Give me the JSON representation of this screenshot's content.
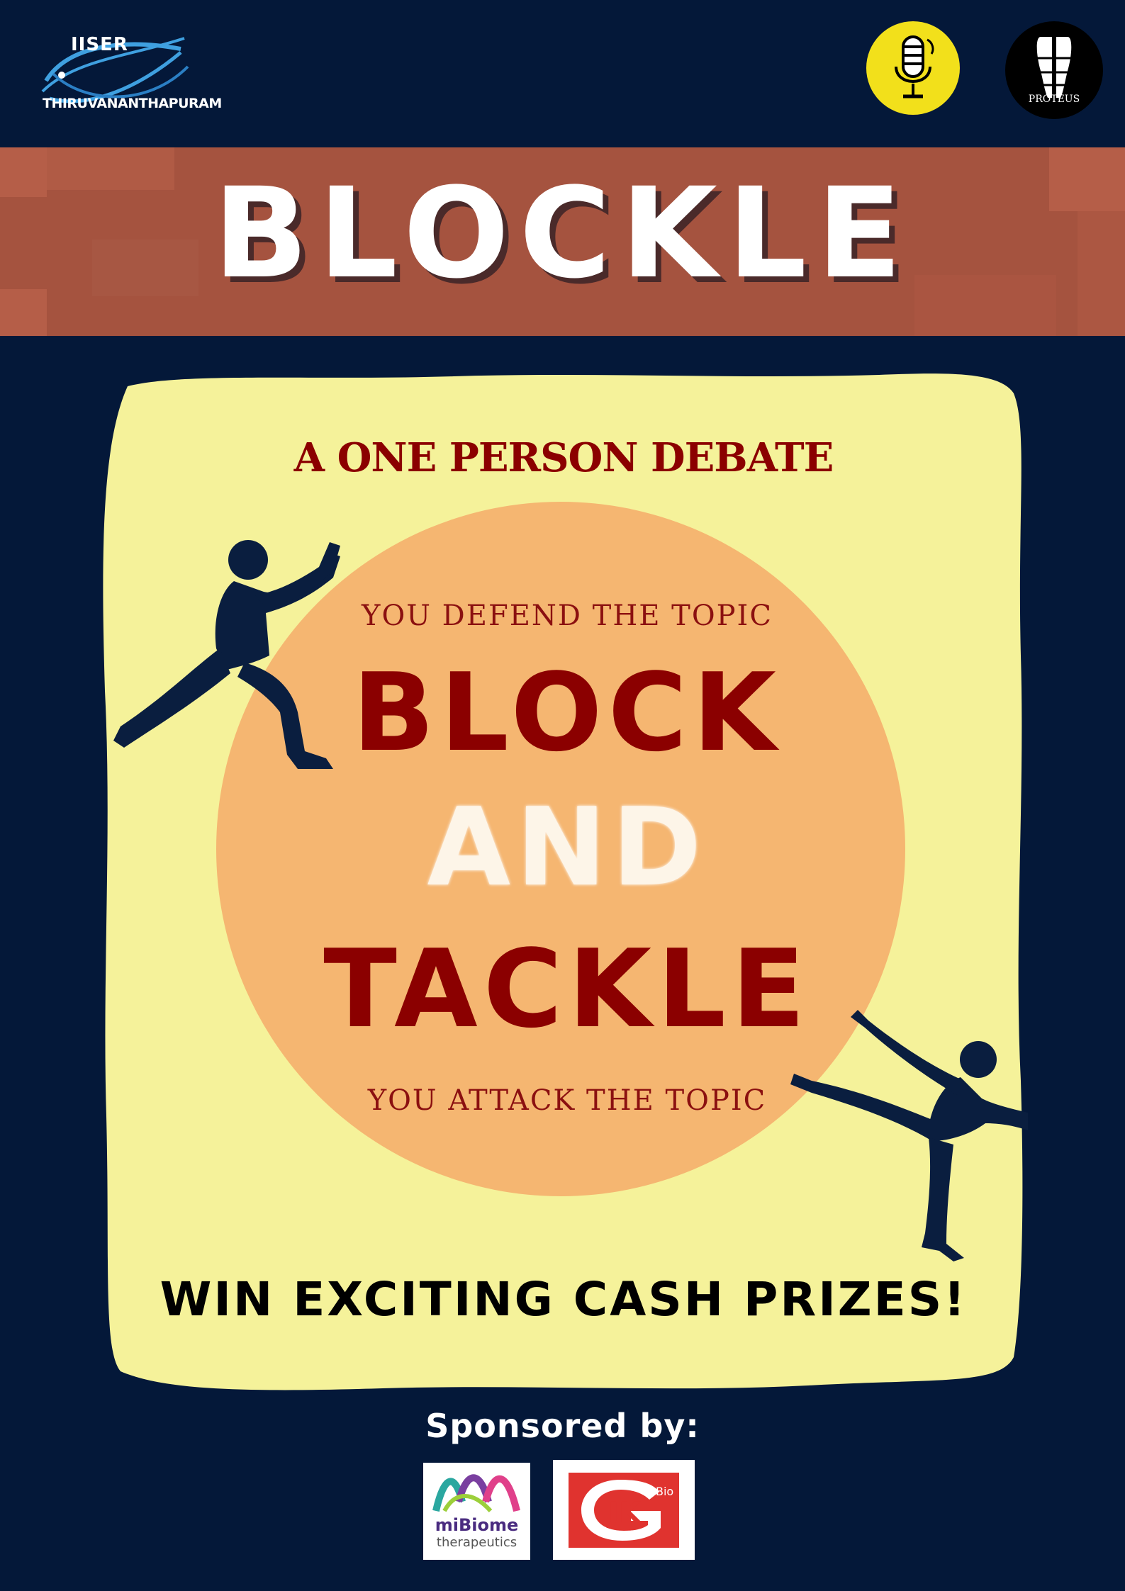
{
  "header": {
    "iiser_logo_text": "IISER",
    "iiser_logo_sub": "THIRUVANANTHAPURAM",
    "proteus_logo_text": "PROTEUS"
  },
  "banner": {
    "title": "BLOCKLE"
  },
  "panel": {
    "subtitle": "A ONE PERSON DEBATE",
    "defend_text": "YOU DEFEND THE TOPIC",
    "word_block": "BLOCK",
    "word_and": "AND",
    "word_tackle": "TACKLE",
    "attack_text": "YOU ATTACK THE TOPIC",
    "prizes": "WIN EXCITING CASH PRIZES!"
  },
  "sponsors": {
    "label": "Sponsored by:",
    "mibiome_name": "miBiome",
    "mibiome_sub": "therapeutics",
    "jk_text": "JK",
    "jk_bio": "Bio"
  },
  "colors": {
    "background": "#041839",
    "banner": "#a5533f",
    "panel": "#f5f29a",
    "circle": "#f5b671",
    "dark_red": "#8b0000"
  }
}
